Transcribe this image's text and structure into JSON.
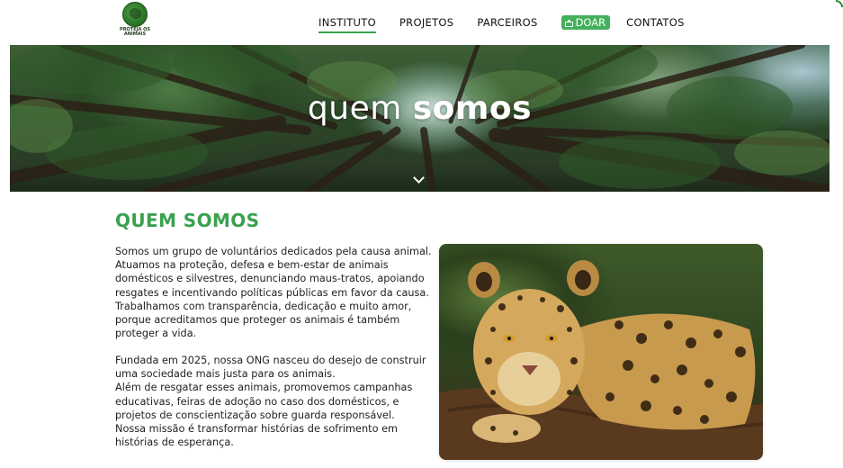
{
  "logo": {
    "line1": "PROTEJA OS",
    "line2": "ANIMAIS",
    "tagline": ""
  },
  "nav": {
    "items": [
      {
        "label": "INSTITUTO",
        "active": true
      },
      {
        "label": "PROJETOS",
        "active": false
      },
      {
        "label": "PARCEIROS",
        "active": false
      }
    ],
    "donate_label": "DOAR",
    "contacts_label": "CONTATOS"
  },
  "hero": {
    "title_light": "quem",
    "title_bold": "somos"
  },
  "content": {
    "section_title": "QUEM SOMOS",
    "paragraph1": [
      "Somos um grupo de voluntários dedicados pela causa animal.",
      "Atuamos na proteção, defesa e bem-estar de animais",
      "domésticos e silvestres, denunciando maus-tratos, apoiando",
      "resgates e incentivando políticas públicas em favor da causa.",
      "Trabalhamos com transparência, dedicação e muito amor,",
      "porque acreditamos que proteger os animais é também",
      "proteger a vida."
    ],
    "paragraph2": [
      "Fundada em 2025, nossa ONG nasceu do desejo de construir",
      "uma sociedade mais justa para os animais.",
      "Além de resgatar esses animais, promovemos campanhas",
      "educativas, feiras de adoção no caso dos domésticos, e",
      "projetos de conscientização sobre guarda responsável.",
      "Nossa missão é transformar histórias de sofrimento em",
      "histórias de esperança."
    ]
  },
  "colors": {
    "accent": "#3aa14f",
    "donate_bg": "#45b05b"
  },
  "icons": {
    "scroll": "chevron-down-icon",
    "donate": "donate-hand-icon"
  }
}
